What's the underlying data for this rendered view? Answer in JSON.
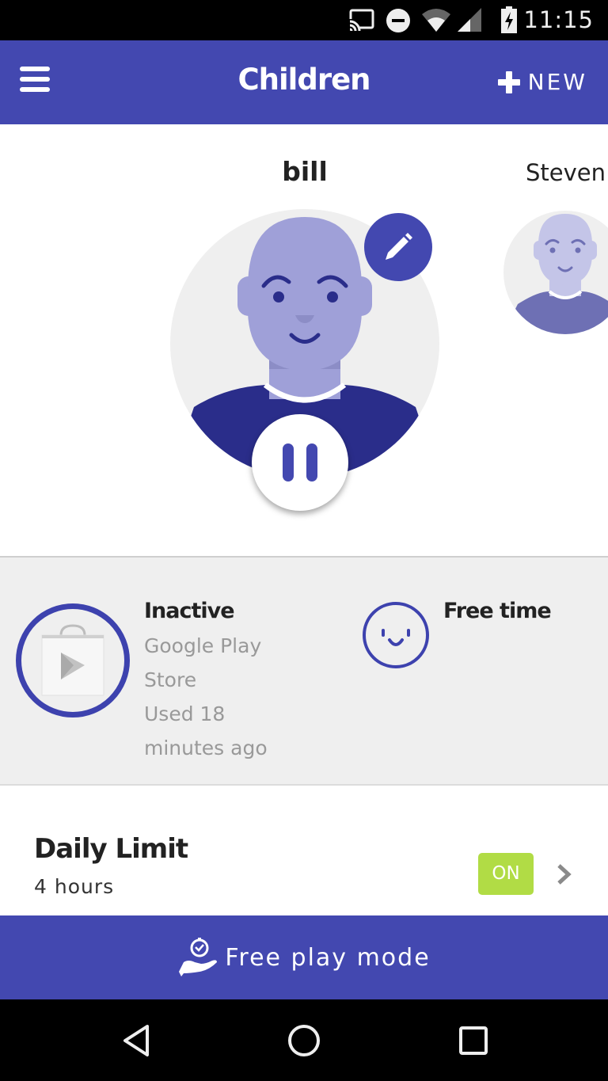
{
  "status_bar": {
    "time": "11:15",
    "icons": [
      "cast-icon",
      "do-not-disturb-icon",
      "wifi-icon",
      "cell-signal-icon",
      "battery-charging-icon"
    ]
  },
  "app_bar": {
    "title": "Children",
    "menu_icon": "hamburger-menu-icon",
    "new_label": "NEW",
    "new_icon": "plus-icon"
  },
  "children": [
    {
      "name": "bill",
      "selected": true
    },
    {
      "name": "Steven",
      "selected": false
    }
  ],
  "profile_actions": {
    "edit_icon": "pencil-icon",
    "pause_icon": "pause-icon"
  },
  "activity": {
    "app_status": "Inactive",
    "app_name_line1": "Google Play",
    "app_name_line2": "Store",
    "used_line1": "Used 18",
    "used_line2": "minutes ago",
    "app_icon": "google-play-store-icon",
    "mode_label": "Free time",
    "mode_icon": "smiley-icon"
  },
  "daily_limit": {
    "title": "Daily Limit",
    "value": "4 hours",
    "status": "ON"
  },
  "free_play": {
    "label": "Free play mode",
    "icon": "hand-clock-icon"
  },
  "colors": {
    "primary": "#4348b0",
    "on_badge": "#b1dc45",
    "avatar_skin": "#9fa0d8",
    "avatar_shirt": "#2a2d8a"
  }
}
